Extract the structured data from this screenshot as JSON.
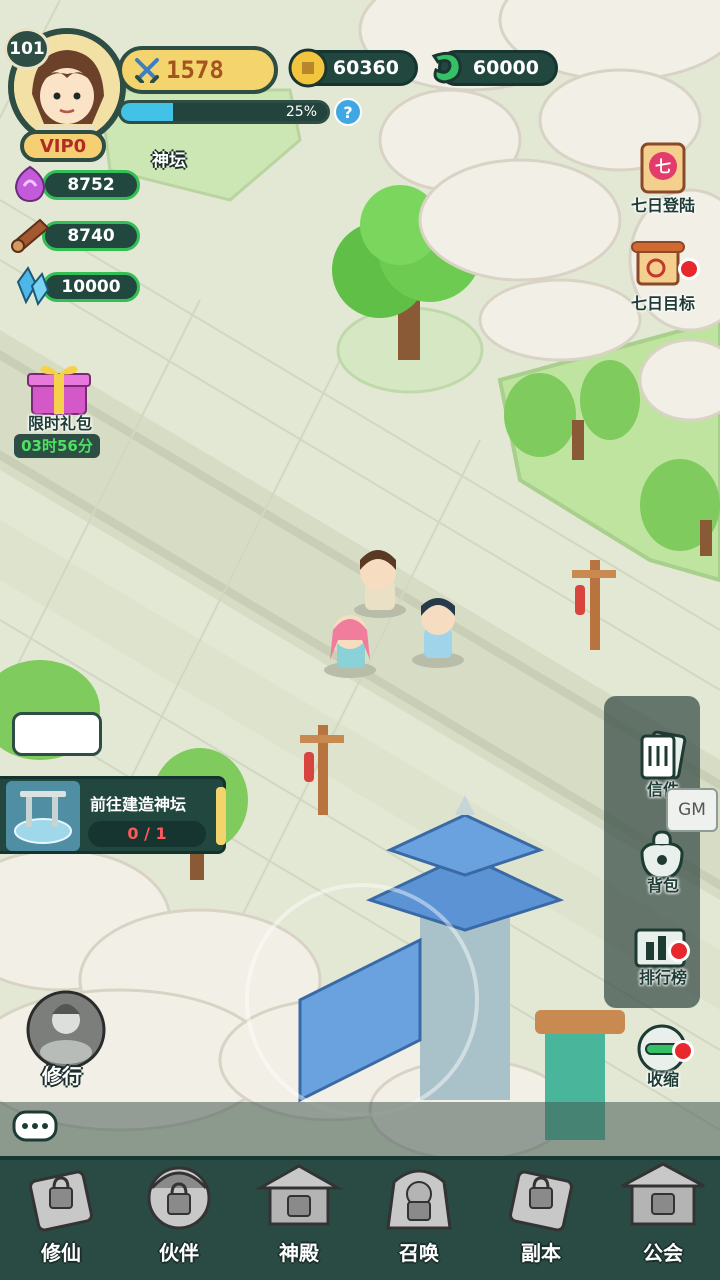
{
  "player": {
    "level": "101",
    "vip": "VIP0",
    "power": "1578",
    "exp_percent_label": "25%",
    "exp_fraction": 0.25
  },
  "currencies": {
    "coins": "60360",
    "jade": "60000"
  },
  "resources": [
    {
      "name": "spirit-orb-icon",
      "value": "8752"
    },
    {
      "name": "wood-log-icon",
      "value": "8740"
    },
    {
      "name": "crystal-icon",
      "value": "10000"
    }
  ],
  "map": {
    "building_label": "神坛"
  },
  "gift": {
    "label": "限时礼包",
    "timer": "03时56分"
  },
  "right_top": [
    {
      "label": "七日登陆"
    },
    {
      "label": "七日目标"
    }
  ],
  "right_panel": [
    {
      "label": "信件"
    },
    {
      "label": "背包"
    },
    {
      "label": "排行榜"
    }
  ],
  "gm_label": "GM",
  "collapse_label": "收缩",
  "cultivate_label": "修行",
  "task": {
    "title": "前往建造神坛",
    "progress": "0 / 1"
  },
  "nav": [
    {
      "label": "修仙"
    },
    {
      "label": "伙伴"
    },
    {
      "label": "神殿"
    },
    {
      "label": "召唤"
    },
    {
      "label": "副本"
    },
    {
      "label": "公会"
    }
  ],
  "colors": {
    "panel": "#22473f",
    "accent_green": "#33bf55",
    "red_dot": "#e7282d",
    "gold": "#f4d46c"
  }
}
